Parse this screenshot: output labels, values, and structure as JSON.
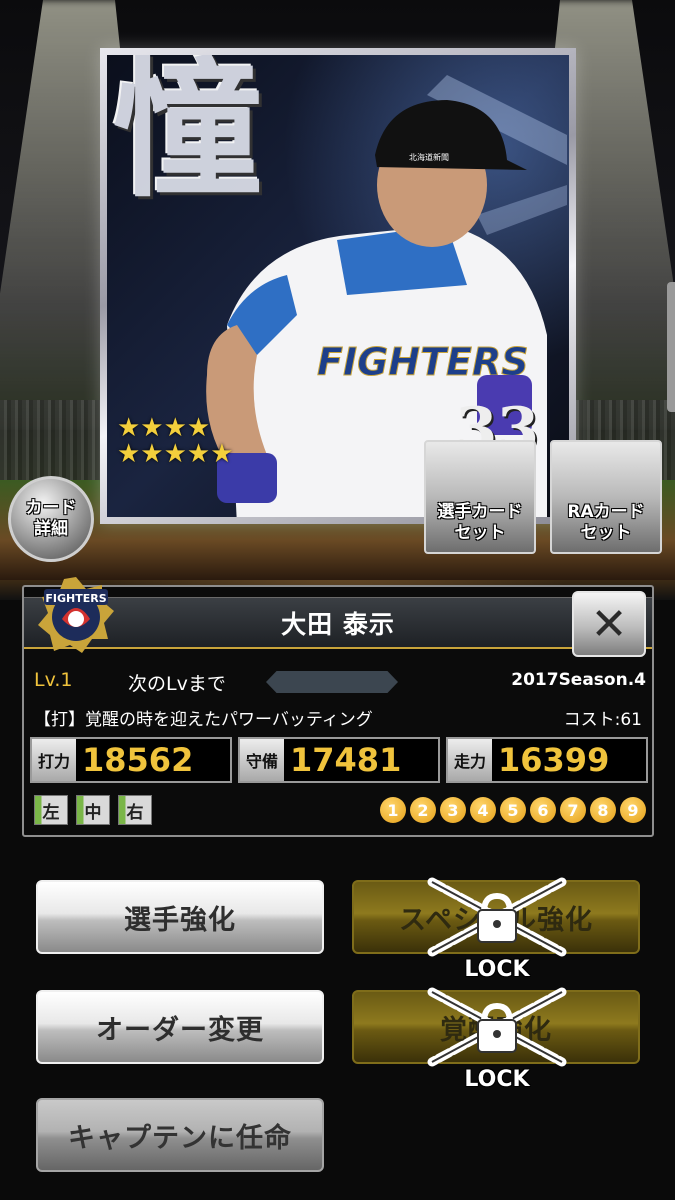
{
  "card": {
    "kanji": "憧",
    "stars": "★★★★\n★★★★★",
    "card_number": "33",
    "detail_button": "カード\n詳細",
    "player_card_set_button": "選手カード\nセット",
    "ra_card_set_button": "RAカード\nセット"
  },
  "player": {
    "name": "大田 泰示",
    "level": "Lv.1",
    "next_level_label": "次のLvまで",
    "season": "2017Season.4",
    "skill": "【打】覚醒の時を迎えたパワーバッティング",
    "cost": "コスト:61",
    "team_logo_text": "FIGHTERS"
  },
  "stats": [
    {
      "label": "打力",
      "value": "18562"
    },
    {
      "label": "守備",
      "value": "17481"
    },
    {
      "label": "走力",
      "value": "16399"
    }
  ],
  "positions": [
    "左",
    "中",
    "右"
  ],
  "batting_orders": [
    "1",
    "2",
    "3",
    "4",
    "5",
    "6",
    "7",
    "8",
    "9"
  ],
  "actions": {
    "enhance": "選手強化",
    "special_enhance": "スペシャル強化",
    "order_change": "オーダー変更",
    "awaken_enhance": "覚醒強化",
    "captain": "キャプテンに任命",
    "lock_label": "LOCK"
  },
  "close_label": "✕",
  "colors": {
    "accent_gold": "#f0c33c",
    "locked_gold": "#8e7a1e",
    "panel_border": "#8e8e8e"
  }
}
